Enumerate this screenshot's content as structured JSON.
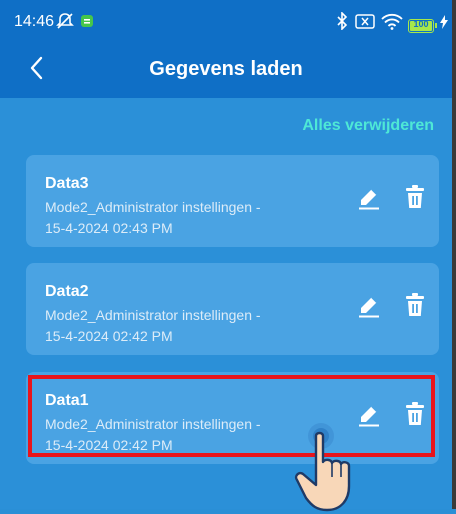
{
  "status_bar": {
    "time": "14:46",
    "battery_level": "100",
    "battery_percent": 100,
    "icons": [
      "mute-icon",
      "app-notification-icon",
      "bluetooth-icon",
      "no-sim-icon",
      "wifi-icon",
      "battery-icon",
      "charging-icon"
    ]
  },
  "header": {
    "title": "Gegevens laden",
    "back_icon": "chevron-left-icon"
  },
  "actions": {
    "delete_all_label": "Alles verwijderen"
  },
  "colors": {
    "header": "#0f6fc6",
    "background": "#2b90d8",
    "card": "#4aa3e3",
    "accent": "#4ee8d6",
    "highlight": "#e8141c"
  },
  "records": [
    {
      "name": "Data3",
      "description": "Mode2_Administrator instellingen -",
      "timestamp": "15-4-2024 02:43 PM"
    },
    {
      "name": "Data2",
      "description": "Mode2_Administrator instellingen -",
      "timestamp": "15-4-2024 02:42 PM"
    },
    {
      "name": "Data1",
      "description": "Mode2_Administrator instellingen -",
      "timestamp": "15-4-2024 02:42 PM"
    }
  ],
  "annotation": {
    "highlighted_record": "Data1",
    "pointer_icon": "tapping-hand-icon"
  }
}
